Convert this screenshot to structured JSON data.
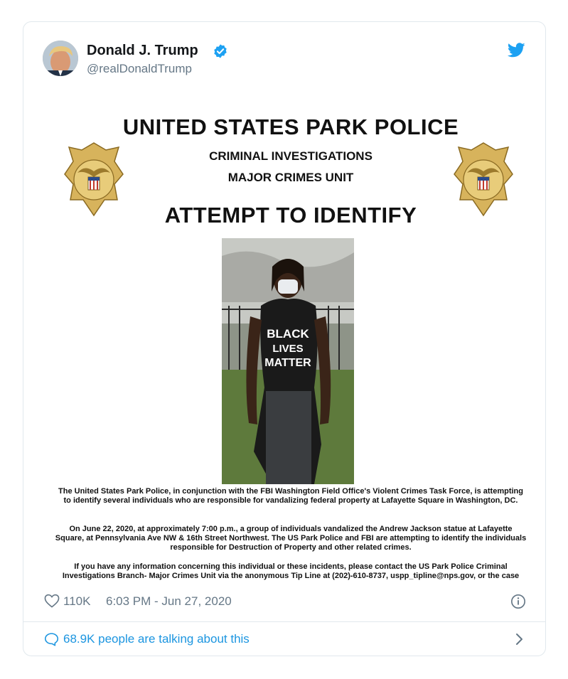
{
  "tweet": {
    "author_name": "Donald J. Trump",
    "handle": "@realDonaldTrump",
    "likes": "110K",
    "timestamp": "6:03 PM - Jun 27, 2020",
    "conversation_text": "68.9K people are talking about this"
  },
  "poster": {
    "title": "UNITED STATES PARK POLICE",
    "subtitle_line1": "CRIMINAL INVESTIGATIONS",
    "subtitle_line2": "MAJOR CRIMES UNIT",
    "heading": "ATTEMPT TO IDENTIFY",
    "badge_text": "UNITED STATES PARK POLICE",
    "shirt_text": [
      "BLACK",
      "LIVES",
      "MATTER"
    ],
    "paragraph1": "The United States Park Police, in conjunction with the FBI Washington Field Office's Violent Crimes Task Force, is attempting to identify several individuals who are responsible for vandalizing federal property at Lafayette Square in Washington, DC.",
    "paragraph2": "On June 22, 2020, at approximately 7:00 p.m., a group of individuals vandalized the Andrew Jackson statue at Lafayette Square, at Pennsylvania Ave NW & 16th Street Northwest. The US Park Police and FBI are attempting to identify the individuals responsible for Destruction of Property and other related crimes.",
    "paragraph3": "If you have any information concerning this individual or these incidents, please contact the US Park Police Criminal Investigations Branch- Major Crimes Unit via the anonymous Tip Line at (202)-610-8737, uspp_tipline@nps.gov, or the case"
  },
  "icons": {
    "verified": "verified-badge-icon",
    "twitter": "twitter-bird-icon",
    "like": "heart-icon",
    "info": "info-icon",
    "reply": "speech-bubble-icon",
    "chevron": "chevron-right-icon"
  },
  "colors": {
    "twitter_blue": "#1da1f2",
    "link_blue": "#1b95e0",
    "secondary_text": "#657786",
    "border": "#e1e8ed"
  }
}
